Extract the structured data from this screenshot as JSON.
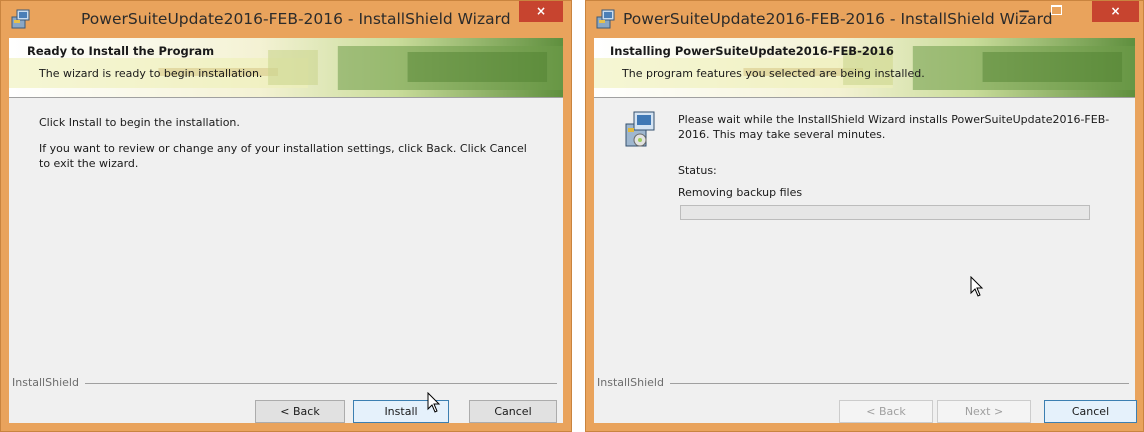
{
  "installer_left": {
    "window_title": "PowerSuiteUpdate2016-FEB-2016 - InstallShield Wizard",
    "close_glyph": "×",
    "banner_title": "Ready to Install the Program",
    "banner_subtitle": "The wizard is ready to begin installation.",
    "paragraph_1": "Click Install to begin the installation.",
    "paragraph_2": "If you want to review or change any of your installation settings, click Back. Click Cancel to exit the wizard.",
    "brand": "InstallShield",
    "buttons": {
      "back": "< Back",
      "install": "Install",
      "cancel": "Cancel"
    }
  },
  "installer_right": {
    "window_title": "PowerSuiteUpdate2016-FEB-2016 - InstallShield Wizard",
    "minimize_glyph": "−",
    "close_glyph": "×",
    "banner_title": "Installing PowerSuiteUpdate2016-FEB-2016",
    "banner_subtitle": "The program features you selected are being installed.",
    "message": "Please wait while the InstallShield Wizard installs PowerSuiteUpdate2016-FEB-2016. This may take several minutes.",
    "status_label": "Status:",
    "status_value": "Removing backup files",
    "progress_fraction": 0.0,
    "brand": "InstallShield",
    "buttons": {
      "back": "< Back",
      "next": "Next >",
      "cancel": "Cancel"
    }
  },
  "colors": {
    "window_frame": "#e9a35c",
    "close_button": "#c7442f",
    "dialog_background": "#f0f0f0",
    "progress_fill": "#06b025"
  },
  "icons": [
    "installer-app-icon",
    "setup-package-icon",
    "mouse-pointer-icon"
  ]
}
